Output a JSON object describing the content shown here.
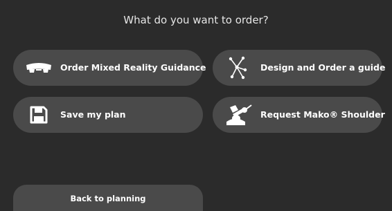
{
  "dialog": {
    "title": "What do you want to order?"
  },
  "options": [
    {
      "label": "Order Mixed Reality Guidance",
      "icon": "headset-icon"
    },
    {
      "label": "Design and Order a guide",
      "icon": "guide-nodes-icon"
    },
    {
      "label": "Save my plan",
      "icon": "floppy-disk-icon"
    },
    {
      "label": "Request Mako® Shoulder",
      "icon": "robotic-arm-icon"
    }
  ],
  "footer": {
    "back_label": "Back to planning"
  },
  "colors": {
    "background": "#2b2b2b",
    "button": "#4a4a4a",
    "text": "#ffffff"
  }
}
